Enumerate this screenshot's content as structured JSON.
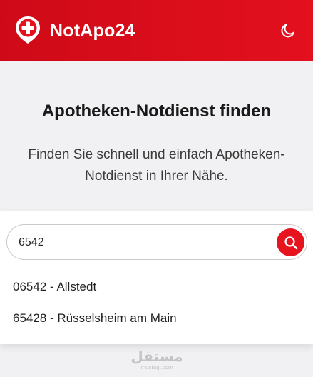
{
  "header": {
    "brand": "NotApo24",
    "logo_icon": "pharmacy-cross-pin-icon",
    "theme_toggle_icon": "moon-icon",
    "background_color": "#e3101e"
  },
  "hero": {
    "title": "Apotheken-Notdienst finden",
    "subtitle": "Finden Sie schnell und einfach Apotheken-Notdienst in Ihrer Nähe."
  },
  "search": {
    "value": "6542",
    "button_icon": "search-icon",
    "button_color": "#e5141f",
    "suggestions": [
      {
        "label": "06542 - Allstedt"
      },
      {
        "label": "65428 - Rüsselsheim am Main"
      }
    ]
  },
  "watermark": {
    "text": "مستقل",
    "subtext": "mostaql.com"
  }
}
